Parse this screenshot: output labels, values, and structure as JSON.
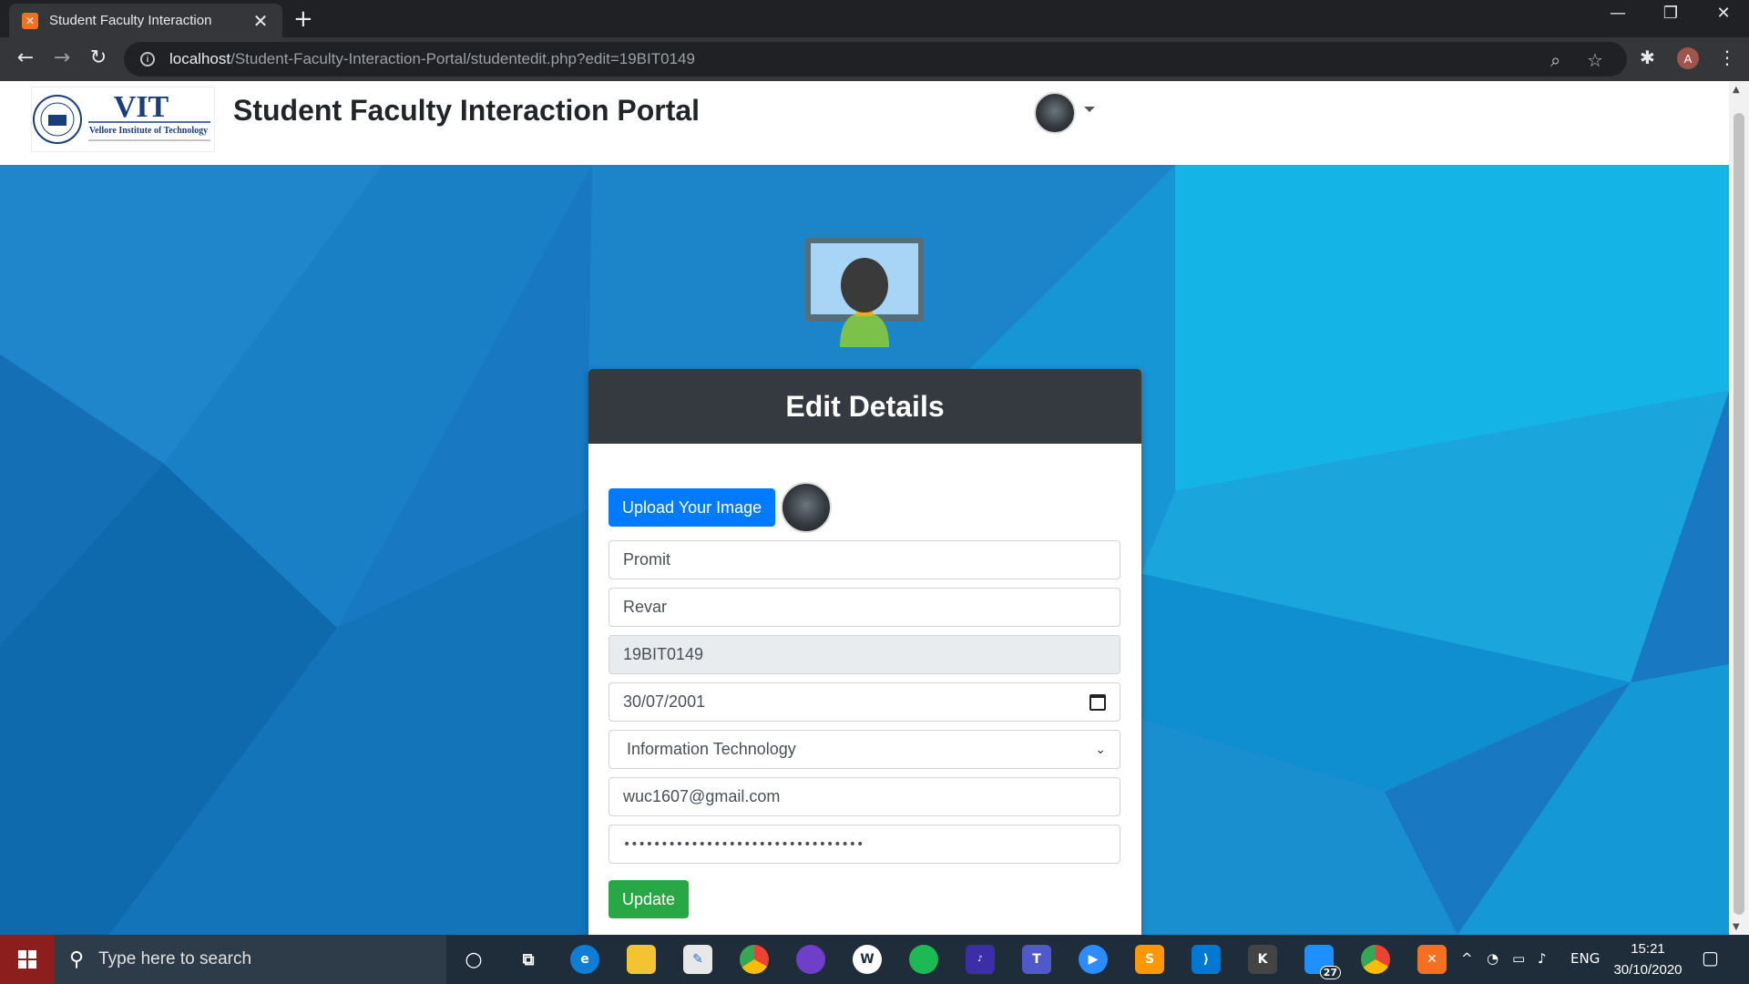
{
  "browser": {
    "tab_title": "Student Faculty Interaction",
    "tab_close": "✕",
    "new_tab": "+",
    "url_host": "localhost",
    "url_path": "/Student-Faculty-Interaction-Portal/studentedit.php?edit=19BIT0149",
    "profile_initial": "A"
  },
  "site": {
    "title": "Student Faculty Interaction Portal",
    "logo_text": "VIT",
    "logo_sub": "Vellore Institute of Technology"
  },
  "form": {
    "heading": "Edit Details",
    "upload_label": "Upload Your Image",
    "first_name": "Promit",
    "last_name": "Revar",
    "reg_no": "19BIT0149",
    "dob": "30/07/2001",
    "department": "Information Technology",
    "email": "wuc1607@gmail.com",
    "password": "••••••••••••••••••••••••••••••••",
    "submit_label": "Update"
  },
  "taskbar": {
    "search_placeholder": "Type here to search",
    "language": "ENG",
    "time": "15:21",
    "date": "30/10/2020",
    "badge_count": "27"
  },
  "colors": {
    "primary": "#007bff",
    "success": "#28a745",
    "header_dark": "#343a40",
    "page_bg": "#1a7fc7"
  }
}
